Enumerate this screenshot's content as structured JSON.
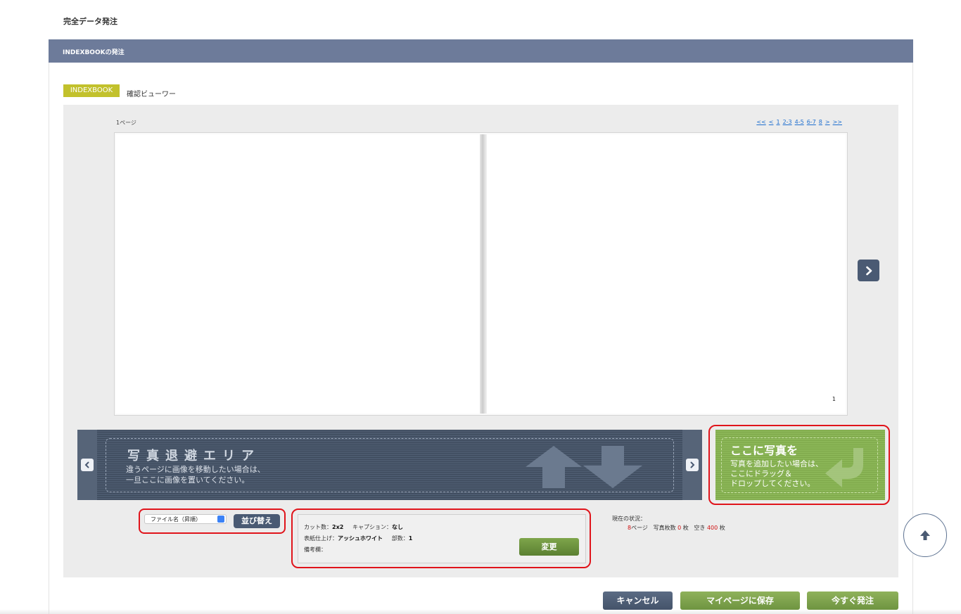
{
  "page_title": "完全データ発注",
  "section_title": "INDEXBOOKの発注",
  "tag": {
    "label": "INDEXBOOK",
    "color": "#c2c12c"
  },
  "viewer_label": "確認ビューワー",
  "viewer": {
    "page_label": "1ページ",
    "pager": [
      "<<",
      "<",
      "1",
      "2-3",
      "4-5",
      "6-7",
      "8",
      ">",
      ">>"
    ],
    "page_number": "1",
    "next_icon": "chevron-right-icon"
  },
  "stash_area": {
    "title": "写真退避エリア",
    "lines": [
      "違うページに画像を移動したい場合は、",
      "一旦ここに画像を置いてください。"
    ],
    "prev_icon": "chevron-left-icon",
    "next_icon": "chevron-right-icon"
  },
  "drop_area": {
    "title": "ここに写真を",
    "lines": [
      "写真を追加したい場合は、",
      "ここにドラッグ＆",
      "ドロップしてください。"
    ]
  },
  "sort": {
    "selected": "ファイル名（昇順）",
    "button_label": "並び替え"
  },
  "settings": {
    "cut_label": "カット数：",
    "cut_value": "2x2",
    "caption_label": "キャプション：",
    "caption_value": "なし",
    "cover_label": "表紙仕上げ：",
    "cover_value": "アッシュホワイト",
    "copies_label": "部数：",
    "copies_value": "1",
    "notes_label": "備考欄：",
    "change_button": "変更"
  },
  "status": {
    "heading": "現在の状況：",
    "pages_value": "8",
    "pages_unit": "ページ",
    "photos_label": "写真枚数",
    "photos_value": "0",
    "photos_unit": "枚",
    "free_label": "空き",
    "free_value": "400",
    "free_unit": "枚"
  },
  "footer": {
    "cancel": "キャンセル",
    "save": "マイページに保存",
    "order": "今すぐ発注"
  },
  "scroll_top_icon": "arrow-up-icon",
  "colors": {
    "header_bar": "#6d7b9a",
    "dark_button": "#4a5a73",
    "green_button": "#7ea54b",
    "highlight": "#e0141b",
    "status_red": "#d01010"
  }
}
